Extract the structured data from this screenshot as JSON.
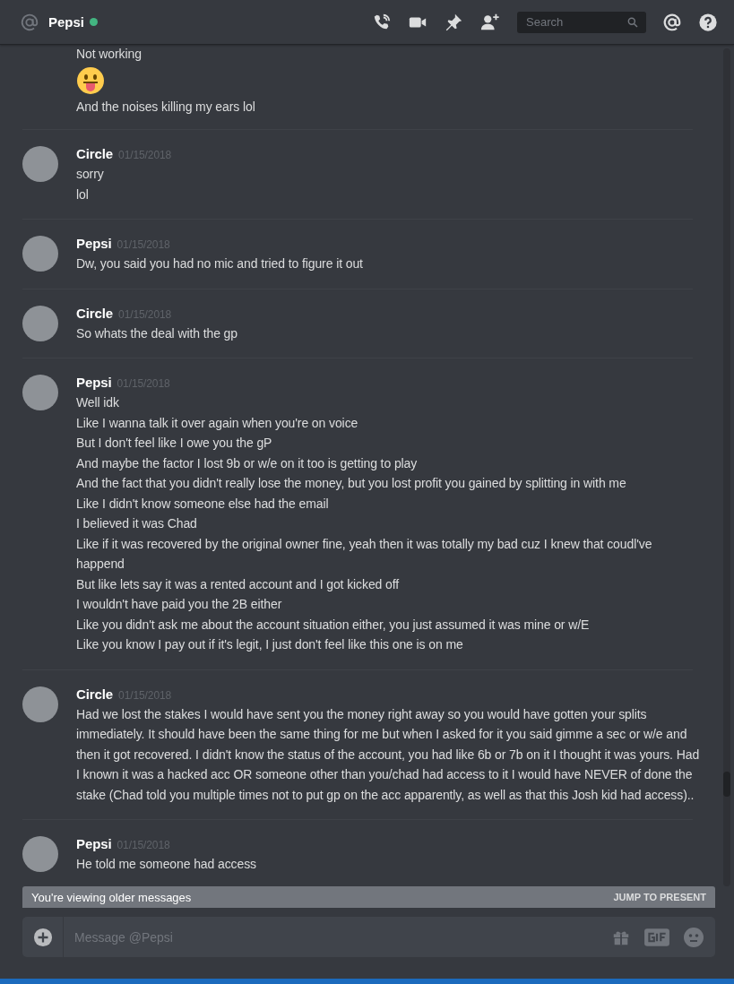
{
  "header": {
    "name": "Pepsi",
    "online": true,
    "search": {
      "placeholder": "Search"
    }
  },
  "groups": [
    {
      "lines": [
        {
          "kind": "text",
          "text": "Not working"
        },
        {
          "kind": "emoji"
        },
        {
          "kind": "text",
          "text": "And the noises killing my ears lol"
        }
      ]
    },
    {
      "author": "Circle",
      "date": "01/15/2018",
      "lines": [
        {
          "kind": "text",
          "text": "sorry"
        },
        {
          "kind": "text",
          "text": "lol"
        }
      ]
    },
    {
      "author": "Pepsi",
      "date": "01/15/2018",
      "lines": [
        {
          "kind": "text",
          "text": "Dw, you said you had no mic and tried to figure it out"
        }
      ]
    },
    {
      "author": "Circle",
      "date": "01/15/2018",
      "lines": [
        {
          "kind": "text",
          "text": "So whats the deal with the gp"
        }
      ]
    },
    {
      "author": "Pepsi",
      "date": "01/15/2018",
      "lines": [
        {
          "kind": "text",
          "text": "Well idk"
        },
        {
          "kind": "text",
          "text": "Like I wanna talk it over again when you're on voice"
        },
        {
          "kind": "text",
          "text": "But I don't feel like I owe you the gP"
        },
        {
          "kind": "text",
          "text": "And maybe the factor I lost 9b or w/e on it too is getting to play"
        },
        {
          "kind": "text",
          "text": "And the fact that you didn't really lose the money, but you lost profit you gained by splitting in with me"
        },
        {
          "kind": "text",
          "text": "Like I didn't know someone else had the email"
        },
        {
          "kind": "text",
          "text": "I believed it was Chad"
        },
        {
          "kind": "text",
          "text": "Like if it was recovered by the original owner fine, yeah then it was totally my bad cuz I knew that coudl've happend"
        },
        {
          "kind": "text",
          "text": "But like lets say it was a rented account and I got kicked off"
        },
        {
          "kind": "text",
          "text": "I wouldn't have paid you the 2B either"
        },
        {
          "kind": "text",
          "text": "Like you didn't ask me about the account situation either, you just assumed it was mine or w/E"
        },
        {
          "kind": "text",
          "text": "Like you know I pay out if it's legit, I just don't feel like this one is on me"
        }
      ]
    },
    {
      "author": "Circle",
      "date": "01/15/2018",
      "lines": [
        {
          "kind": "text",
          "text": "Had we lost the stakes I would have sent you the money right away so you would have gotten your splits immediately. It should have been the same thing for me but when I asked for it you said gimme a sec or w/e and then it got recovered. I didn't know the status of the account, you had like 6b or 7b on it I thought it was yours. Had I known it was a hacked acc OR someone other than you/chad had access to it I would have NEVER of done the stake (Chad told you multiple times not to put gp on the acc apparently, as well as that this Josh kid had access).."
        }
      ]
    },
    {
      "author": "Pepsi",
      "date": "01/15/2018",
      "lines": [
        {
          "kind": "text",
          "text": "He told me someone had access"
        }
      ]
    }
  ],
  "banner": {
    "text": "You're viewing older messages",
    "action": "JUMP TO PRESENT"
  },
  "composer": {
    "placeholder": "Message @Pepsi"
  }
}
